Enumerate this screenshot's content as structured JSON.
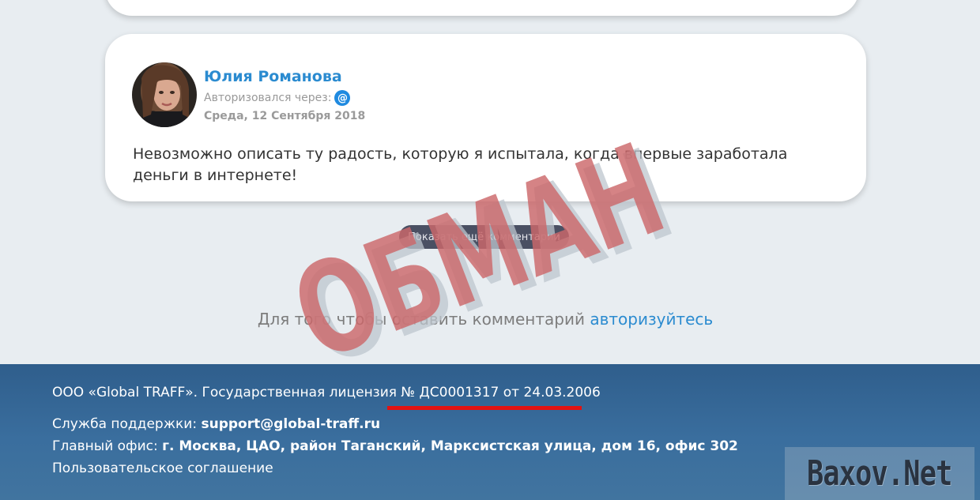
{
  "comment": {
    "author": "Юлия Романова",
    "auth_label": "Авторизовался через:",
    "auth_icon": "at-sign-icon",
    "date": "Среда, 12 Сентября 2018",
    "text": "Невозможно описать ту радость, которую я испытала, когда впервые заработала деньги в интернете!"
  },
  "more_comments_label": "Показать ещё комментарии",
  "login_prompt": {
    "text": "Для того чтобы оставить комментарий",
    "link": "авторизуйтесь"
  },
  "stamp_text": "ОБМАН",
  "footer": {
    "license_prefix": "ООО «Global TRAFF». Государственная лицензия",
    "license_number": "№ ДС0001317 от 24.03.2006",
    "support_label": "Служба поддержки:",
    "support_email": "support@global-traff.ru",
    "office_label": "Главный офис:",
    "office_address": "г. Москва, ЦАО, район Таганский, Марксистская улица, дом 16, офис 302",
    "agreement": "Пользовательское соглашение"
  },
  "watermark": "Baxov.Net",
  "colors": {
    "link": "#2b8bd0",
    "footer_bg": "#3a6e9e",
    "stamp": "#cc686a",
    "underline": "#e21212"
  }
}
